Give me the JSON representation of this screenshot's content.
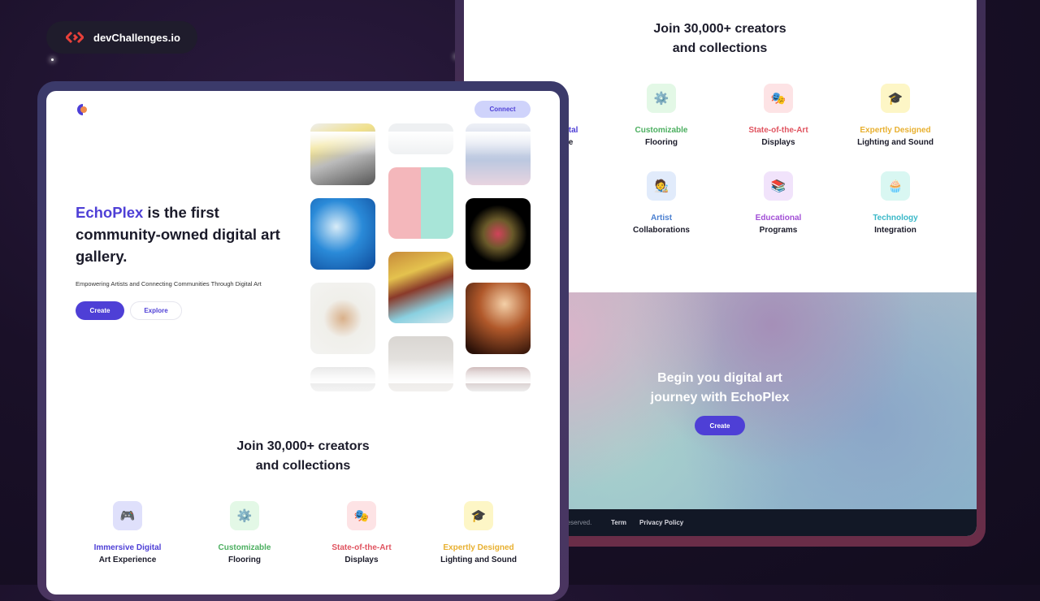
{
  "brand": {
    "name": "devChallenges.io",
    "icon": "code-brackets-icon"
  },
  "colors": {
    "accent": "#4e3fd6",
    "connect_bg": "#cfd3fb",
    "footer_bg": "#121826"
  },
  "hero": {
    "brand_word": "EchoPlex",
    "heading_rest": " is the first community-owned digital art gallery.",
    "subtitle": "Empowering Artists and Connecting Communities Through Digital Art",
    "create": "Create",
    "explore": "Explore",
    "connect": "Connect"
  },
  "join": {
    "line1": "Join 30,000+ creators",
    "line2": "and collections"
  },
  "features": [
    {
      "l1": "Immersive Digital",
      "l2": "Art Experience",
      "color": "#4e3fd6",
      "bg": "#dfe0fb",
      "icon": "🎮"
    },
    {
      "l1": "Customizable",
      "l2": "Flooring",
      "color": "#4caf60",
      "bg": "#e3f8e6",
      "icon": "⚙️"
    },
    {
      "l1": "State-of-the-Art",
      "l2": "Displays",
      "color": "#e05460",
      "bg": "#fde3e5",
      "icon": "🎭"
    },
    {
      "l1": "Expertly Designed",
      "l2": "Lighting and Sound",
      "color": "#e8b030",
      "bg": "#fdf6c6",
      "icon": "🎓"
    },
    {
      "l1": "Artist",
      "l2": "Collaborations",
      "color": "#4a7fd0",
      "bg": "#e1ebfb",
      "icon": "🧑‍🎨"
    },
    {
      "l1": "Educational",
      "l2": "Programs",
      "color": "#a24fd6",
      "bg": "#f1e3fb",
      "icon": "📚"
    },
    {
      "l1": "Technology",
      "l2": "Integration",
      "color": "#3ab8c8",
      "bg": "#d9f7f2",
      "icon": "🧁"
    }
  ],
  "cta": {
    "title": "Begin you digital art journey with EchoPlex",
    "button": "Create"
  },
  "footer": {
    "reserved": "reserved.",
    "term": "Term",
    "privacy": "Privacy Policy"
  }
}
